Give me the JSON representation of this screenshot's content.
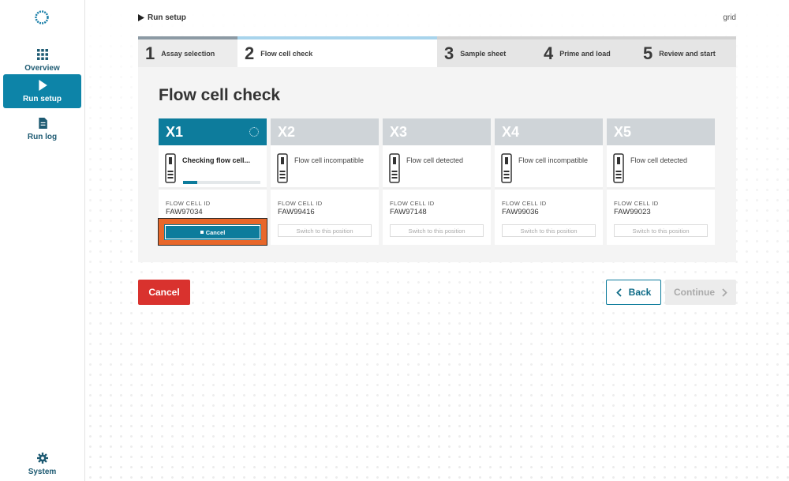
{
  "sidebar": {
    "logo_icon": "sun-ring-logo",
    "items": [
      {
        "label": "Overview",
        "icon": "grid-icon",
        "active": false
      },
      {
        "label": "Run setup",
        "icon": "play-icon",
        "active": true
      },
      {
        "label": "Run log",
        "icon": "document-icon",
        "active": false
      }
    ],
    "system": {
      "label": "System",
      "icon": "gear-icon"
    }
  },
  "header": {
    "breadcrumb": "Run setup",
    "device_name": "grid"
  },
  "steps": [
    {
      "number": "1",
      "label": "Assay selection",
      "state": "done"
    },
    {
      "number": "2",
      "label": "Flow cell check",
      "state": "current"
    },
    {
      "number": "3",
      "label": "Sample sheet",
      "state": "upcoming"
    },
    {
      "number": "4",
      "label": "Prime and load",
      "state": "upcoming"
    },
    {
      "number": "5",
      "label": "Review and start",
      "state": "upcoming"
    }
  ],
  "panel": {
    "title": "Flow cell check",
    "id_header": "FLOW CELL ID",
    "switch_label": "Switch to this position",
    "cancel_label": "Cancel",
    "positions": [
      {
        "name": "X1",
        "status": "Checking flow cell...",
        "flow_cell_id": "FAW97034",
        "active": true,
        "progress": 0.18
      },
      {
        "name": "X2",
        "status": "Flow cell incompatible",
        "flow_cell_id": "FAW99416",
        "active": false
      },
      {
        "name": "X3",
        "status": "Flow cell detected",
        "flow_cell_id": "FAW97148",
        "active": false
      },
      {
        "name": "X4",
        "status": "Flow cell incompatible",
        "flow_cell_id": "FAW99036",
        "active": false
      },
      {
        "name": "X5",
        "status": "Flow cell detected",
        "flow_cell_id": "FAW99023",
        "active": false
      }
    ]
  },
  "footer": {
    "cancel_label": "Cancel",
    "back_label": "Back",
    "continue_label": "Continue"
  },
  "colors": {
    "accent": "#0d7c9c",
    "danger": "#d9322e",
    "highlight": "#e8672a"
  }
}
